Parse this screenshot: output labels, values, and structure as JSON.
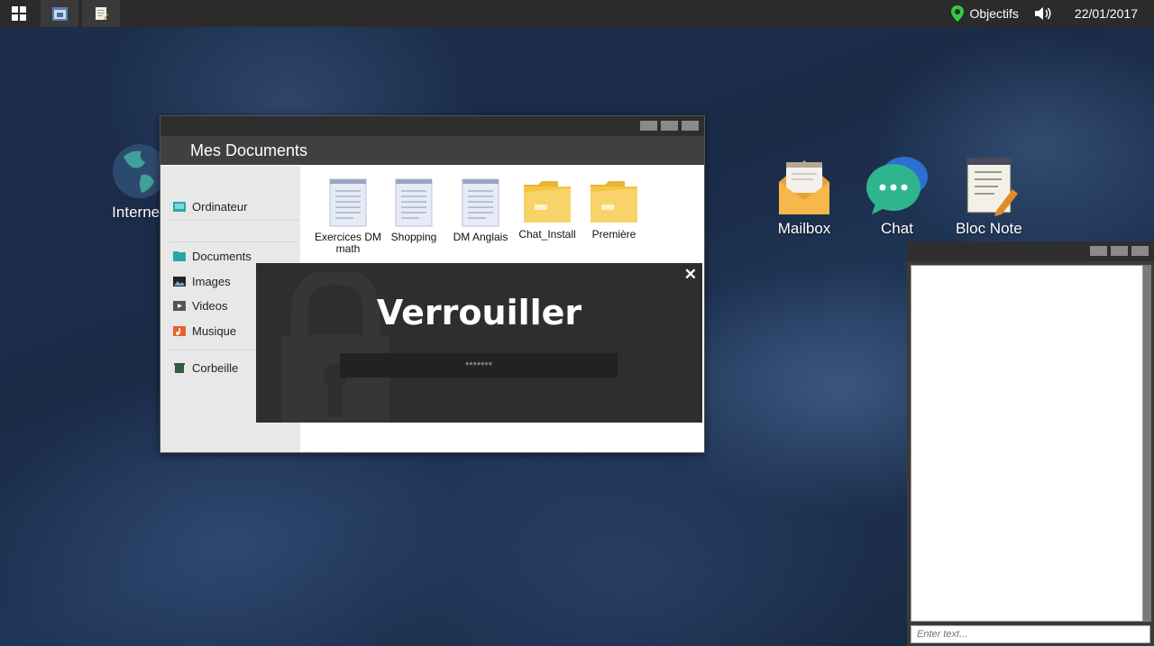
{
  "taskbar": {
    "objectives_label": "Objectifs",
    "date": "22/01/2017"
  },
  "desktop_icons": {
    "internet": "Internet",
    "mailbox": "Mailbox",
    "chat": "Chat",
    "bloc_note": "Bloc Note"
  },
  "documents_window": {
    "title": "Mes Documents",
    "sidebar": {
      "computer": "Ordinateur",
      "documents": "Documents",
      "images": "Images",
      "videos": "Videos",
      "music": "Musique",
      "trash": "Corbeille"
    },
    "files": [
      {
        "name": "Exercices DM math",
        "type": "document"
      },
      {
        "name": "Shopping",
        "type": "document"
      },
      {
        "name": "DM Anglais",
        "type": "document"
      },
      {
        "name": "Chat_Install",
        "type": "folder"
      },
      {
        "name": "Première",
        "type": "folder"
      }
    ]
  },
  "lock_dialog": {
    "title": "Verrouiller",
    "password_placeholder": "*******",
    "close_symbol": "✕"
  },
  "notepad_window": {
    "input_placeholder": "Enter text..."
  },
  "colors": {
    "folder": "#f5c542",
    "taskbar": "#2b2b2b",
    "window_header": "#404040"
  }
}
